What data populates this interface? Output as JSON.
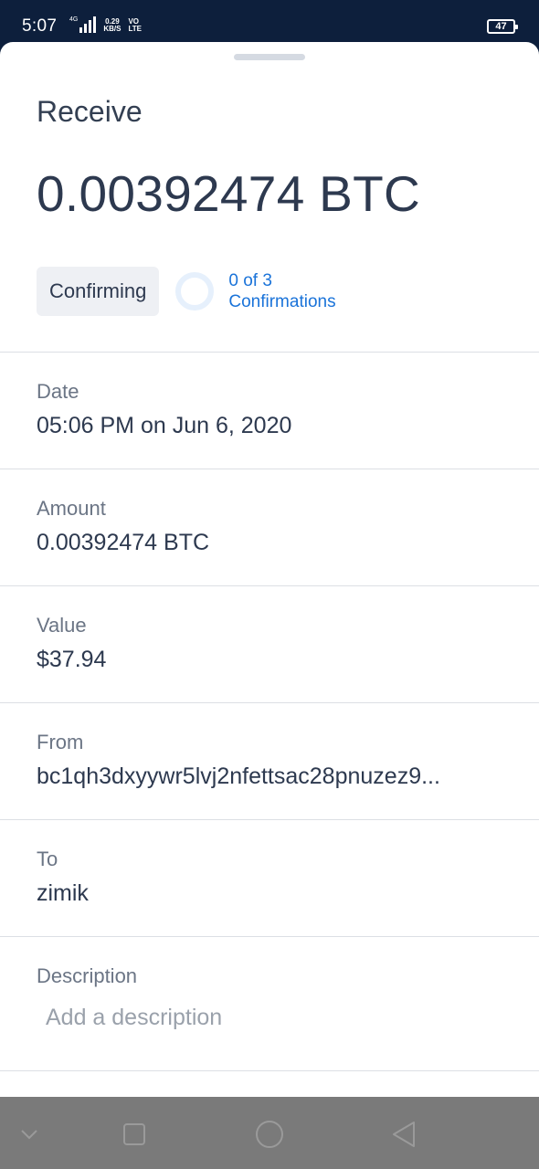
{
  "status_bar": {
    "time": "5:07",
    "network": "4G",
    "speed_value": "0.29",
    "speed_unit": "KB/S",
    "volte_top": "VO",
    "volte_bottom": "LTE",
    "battery": "47"
  },
  "sheet": {
    "title": "Receive",
    "amount": "0.00392474 BTC",
    "status_badge": "Confirming",
    "confirmations_line1": "0 of 3",
    "confirmations_line2": "Confirmations",
    "confirmations_progress": 0
  },
  "details": {
    "date": {
      "label": "Date",
      "value": "05:06 PM on Jun 6, 2020"
    },
    "amount": {
      "label": "Amount",
      "value": "0.00392474 BTC"
    },
    "value": {
      "label": "Value",
      "value": "$37.94"
    },
    "from": {
      "label": "From",
      "value": "bc1qh3dxyywr5lvj2nfettsac28pnuzez9..."
    },
    "to": {
      "label": "To",
      "value": "zimik"
    },
    "description": {
      "label": "Description",
      "placeholder": "Add a description",
      "value": ""
    }
  },
  "nav": {
    "icons": [
      "chevron-down-icon",
      "recent-apps-icon",
      "home-icon",
      "back-icon"
    ]
  },
  "colors": {
    "status_bar_bg": "#0d1f3c",
    "accent_blue": "#1a73d9",
    "text_dark": "#2d394f",
    "label_gray": "#6b7585"
  }
}
